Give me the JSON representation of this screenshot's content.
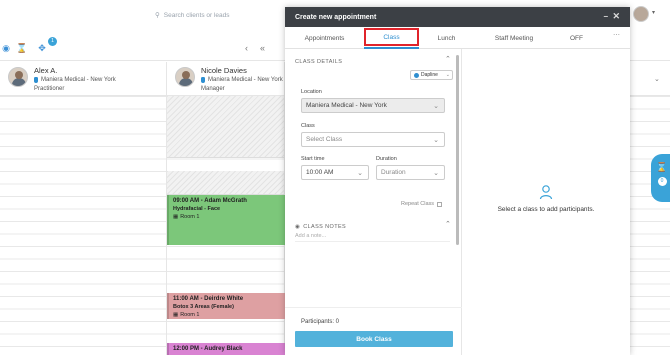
{
  "search": {
    "placeholder": "Search clients or leads"
  },
  "toolbar": {
    "badge_count": "1"
  },
  "staff": [
    {
      "name": "Alex A.",
      "location": "Maniera Medical - New York",
      "role": "Practitioner"
    },
    {
      "name": "Nicole Davies",
      "location": "Maniera Medical - New York",
      "role": "Manager"
    }
  ],
  "appointments": [
    {
      "time": "09:00 AM - Adam McGrath",
      "service": "Hydrafacial - Face",
      "room": "Room 1",
      "color": "#7cc77a"
    },
    {
      "time": "11:00 AM - Deirdre White",
      "service": "Botox 3 Areas (Female)",
      "room": "Room 1",
      "color": "#dea0a2"
    },
    {
      "time": "12:00 PM - Audrey Black",
      "service": "",
      "room": "",
      "color": "#d983d2"
    }
  ],
  "side_panel": {
    "count": "0"
  },
  "modal": {
    "title": "Create new appointment",
    "tabs": [
      {
        "label": "Appointments",
        "active": false
      },
      {
        "label": "Class",
        "active": true
      },
      {
        "label": "Lunch",
        "active": false
      },
      {
        "label": "Staff Meeting",
        "active": false
      },
      {
        "label": "OFF",
        "active": false
      }
    ],
    "class_details_title": "CLASS DETAILS",
    "timezone": "Dapline",
    "location_label": "Location",
    "location_value": "Maniera Medical - New York",
    "class_label": "Class",
    "class_placeholder": "Select Class",
    "start_time_label": "Start time",
    "start_time_value": "10:00 AM",
    "duration_label": "Duration",
    "duration_placeholder": "Duration",
    "repeat_label": "Repeat Class",
    "notes_title": "CLASS NOTES",
    "notes_placeholder": "Add a note...",
    "participants_label": "Participants: 0",
    "book_label": "Book Class",
    "empty_participants": "Select a class to add participants."
  },
  "colors": {
    "accent": "#2f8fd0",
    "header": "#3c4045",
    "book_button": "#53b2db",
    "highlight_box": "#e0242b"
  }
}
